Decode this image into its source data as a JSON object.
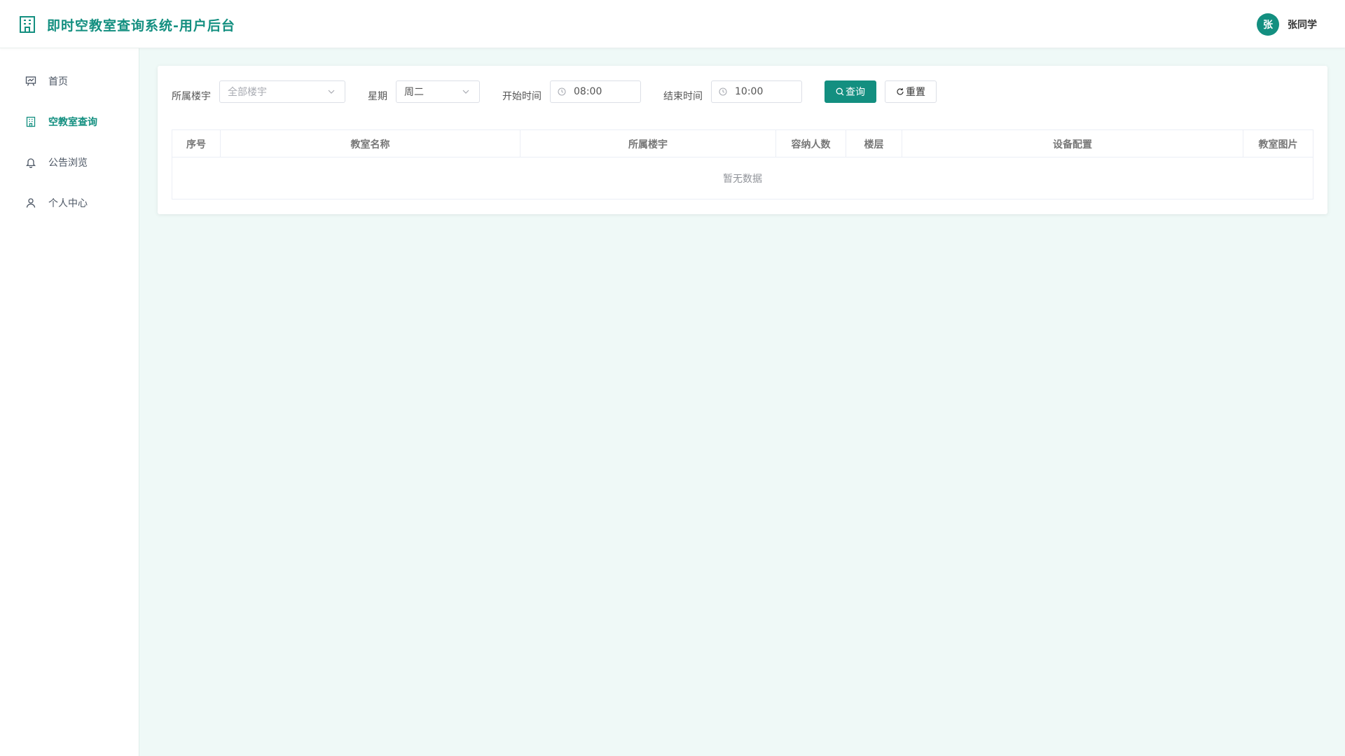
{
  "app": {
    "title": "即时空教室查询系统-用户后台",
    "brand_icon": "building-icon",
    "accent_color": "#138f80"
  },
  "user": {
    "avatar_text": "张",
    "name": "张同学"
  },
  "sidebar": {
    "items": [
      {
        "label": "首页",
        "icon": "presentation-board-icon",
        "active": false
      },
      {
        "label": "空教室查询",
        "icon": "building-icon",
        "active": true
      },
      {
        "label": "公告浏览",
        "icon": "bell-icon",
        "active": false
      },
      {
        "label": "个人中心",
        "icon": "user-icon",
        "active": false
      }
    ]
  },
  "filters": {
    "building_label": "所属楼宇",
    "building_placeholder": "全部楼宇",
    "weekday_label": "星期",
    "weekday_value": "周二",
    "start_label": "开始时间",
    "start_value": "08:00",
    "end_label": "结束时间",
    "end_value": "10:00",
    "query_button": "查询",
    "reset_button": "重置"
  },
  "table": {
    "columns": [
      "序号",
      "教室名称",
      "所属楼宇",
      "容纳人数",
      "楼层",
      "设备配置",
      "教室图片"
    ],
    "empty_text": "暂无数据"
  }
}
